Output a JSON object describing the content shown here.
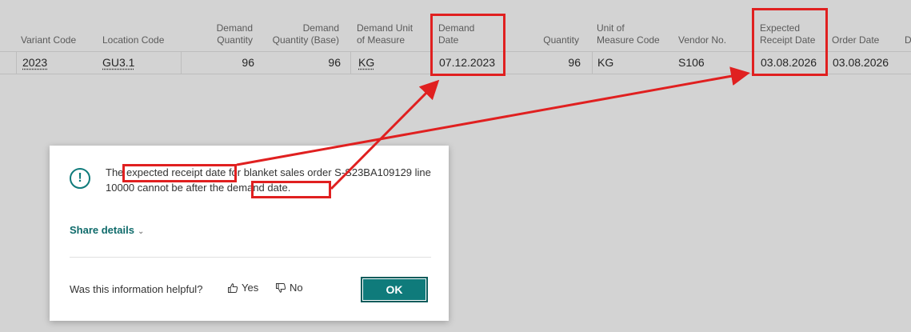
{
  "columns": {
    "variant_code": "Variant Code",
    "location_code": "Location Code",
    "demand_quantity": [
      "Demand",
      "Quantity"
    ],
    "demand_quantity_base": [
      "Demand",
      "Quantity (Base)"
    ],
    "demand_uom": [
      "Demand Unit",
      "of Measure"
    ],
    "demand_date": [
      "Demand",
      "Date"
    ],
    "quantity": "Quantity",
    "uom_code": [
      "Unit of",
      "Measure Code"
    ],
    "vendor_no": "Vendor No.",
    "expected_receipt_date": [
      "Expected",
      "Receipt Date"
    ],
    "order_date": "Order Date",
    "cut_off": "D"
  },
  "row": {
    "variant_code": "2023",
    "location_code": "GU3.1",
    "demand_quantity": "96",
    "demand_quantity_base": "96",
    "demand_uom": "KG",
    "demand_date": "07.12.2023",
    "quantity": "96",
    "uom_code": "KG",
    "vendor_no": "S106",
    "expected_receipt_date": "03.08.2026",
    "order_date": "03.08.2026"
  },
  "dialog": {
    "icon": "exclamation-circle-icon",
    "message_part1": "The ",
    "message_highlight1": "expected receipt date",
    "message_part2": " for blanket sales order S-S23BA109129 line 10000 cannot be after the ",
    "message_highlight2": "demand date.",
    "share_details": "Share details",
    "helpful_question": "Was this information helpful?",
    "yes": "Yes",
    "no": "No",
    "ok": "OK"
  },
  "colors": {
    "accent": "#0f7b7b",
    "annotation": "#e02020",
    "backdrop": "#d3d3d3"
  }
}
